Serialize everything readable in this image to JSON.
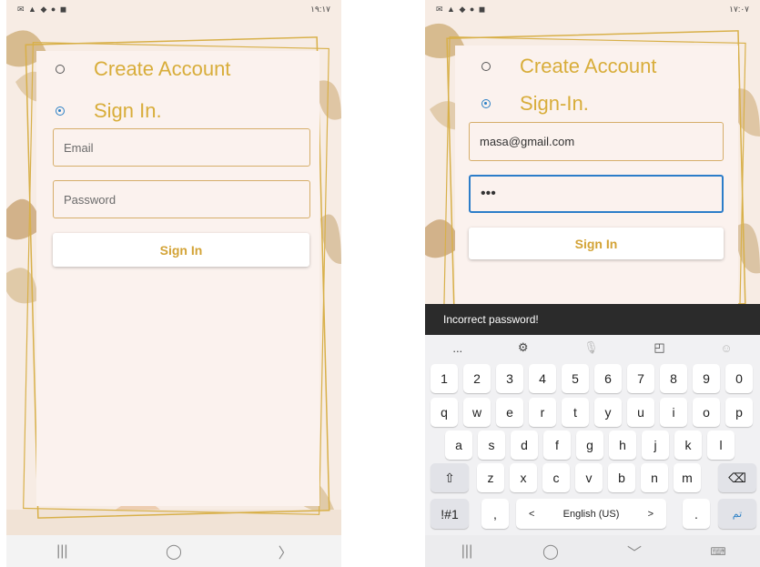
{
  "left": {
    "status_time": "١٩:١٧",
    "options": [
      {
        "label": "Create Account",
        "selected": false
      },
      {
        "label": "Sign In.",
        "selected": true
      }
    ],
    "email": {
      "value": "",
      "placeholder": "Email"
    },
    "password": {
      "value": "",
      "placeholder": "Password"
    },
    "signin_button": "Sign In",
    "nav": {
      "recents": "|||",
      "home": "◯",
      "back": "〉"
    }
  },
  "right": {
    "status_time": "١٧:٠٧",
    "options": [
      {
        "label": "Create Account",
        "selected": false
      },
      {
        "label": "Sign-In.",
        "selected": true
      }
    ],
    "email": {
      "value": "masa@gmail.com"
    },
    "password": {
      "value": "•••"
    },
    "signin_button": "Sign In",
    "toast": "Incorrect password!",
    "keyboard": {
      "tools": [
        "...",
        "gear-icon",
        "mic-icon",
        "sticker-icon",
        "emoji-icon"
      ],
      "row_numbers": [
        "1",
        "2",
        "3",
        "4",
        "5",
        "6",
        "7",
        "8",
        "9",
        "0"
      ],
      "row_q": [
        "q",
        "w",
        "e",
        "r",
        "t",
        "y",
        "u",
        "i",
        "o",
        "p"
      ],
      "row_a": [
        "a",
        "s",
        "d",
        "f",
        "g",
        "h",
        "j",
        "k",
        "l"
      ],
      "row_z": [
        "z",
        "x",
        "c",
        "v",
        "b",
        "n",
        "m"
      ],
      "symbols_key": "!#1",
      "comma_key": ",",
      "space_label": "English (US)",
      "space_left": "<",
      "space_right": ">",
      "period_key": ".",
      "enter_key": "تم"
    },
    "nav": {
      "recents": "|||",
      "home": "◯",
      "back": "﹀",
      "keyboard": "⌨"
    }
  },
  "colors": {
    "gold": "#d8ad3a",
    "blue": "#2a7fc5",
    "card": "#fbf2ee",
    "toast": "#2b2b2b"
  }
}
